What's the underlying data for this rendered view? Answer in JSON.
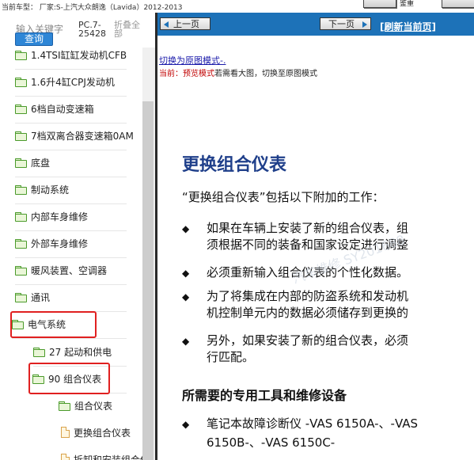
{
  "topbar": {
    "vehicle": "当前车型：  厂家:S-上汽大众朗逸（Lavida）2012-2013",
    "mid_label": "鉴重"
  },
  "sidebar": {
    "search_label": "输入关键字",
    "search_button": "查询",
    "pc_code": "PC.7-25428",
    "collapse_all": "折叠全部",
    "items": [
      {
        "label": "1.4TSI缸缸发动机CFB",
        "type": "folder"
      },
      {
        "label": "1.6升4缸CPJ发动机",
        "type": "folder"
      },
      {
        "label": "6档自动变速箱",
        "type": "folder"
      },
      {
        "label": "7档双离合器变速箱0AM",
        "type": "folder"
      },
      {
        "label": "底盘",
        "type": "folder"
      },
      {
        "label": "制动系统",
        "type": "folder"
      },
      {
        "label": "内部车身维修",
        "type": "folder"
      },
      {
        "label": "外部车身维修",
        "type": "folder"
      },
      {
        "label": "暖风装置、空调器",
        "type": "folder"
      },
      {
        "label": "通讯",
        "type": "folder"
      },
      {
        "label": "电气系统",
        "type": "folder-open"
      },
      {
        "label": "27 起动和供电",
        "type": "folder"
      },
      {
        "label": "90 组合仪表",
        "type": "folder-open"
      },
      {
        "label": "组合仪表",
        "type": "folder-open"
      },
      {
        "label": "更换组合仪表",
        "type": "doc"
      },
      {
        "label": "拆卸和安装组合仪表",
        "type": "doc"
      }
    ]
  },
  "nav": {
    "prev": "上一页",
    "next": "下一页",
    "refresh": "[刷新当前页]"
  },
  "content": {
    "switch_link": "切换为原图模式-.",
    "current_prefix": "当前：",
    "current_mode": "预览模式",
    "current_hint": "若需看大图，切换至原图模式",
    "title": "更换组合仪表",
    "intro": "“更换组合仪表”包括以下附加的工作：",
    "bullets": [
      {
        "lines": [
          "如果在车辆上安装了新的组合仪表，组",
          "须根据不同的装备和国家设定进行调整"
        ]
      },
      {
        "lines": [
          "必须重新输入组合仪表的个性化数据。"
        ]
      },
      {
        "lines": [
          "为了将集成在内部的防盗系统和发动机",
          "机控制单元内的数据必须储存到更换的"
        ]
      },
      {
        "lines": [
          "另外，如果安装了新的组合仪表，必须",
          "行匹配。"
        ]
      }
    ],
    "section": "所需要的专用工具和维修设备",
    "tools": [
      "笔记本故障诊断仪 -VAS 6150A-、-VAS",
      "6150B-、-VAS 6150C-"
    ],
    "watermark": "汽车维修 SY201688"
  },
  "colors": {
    "nav_blue": "#1d72b8",
    "title_blue": "#1f3f8a",
    "highlight_red": "#e02020"
  }
}
